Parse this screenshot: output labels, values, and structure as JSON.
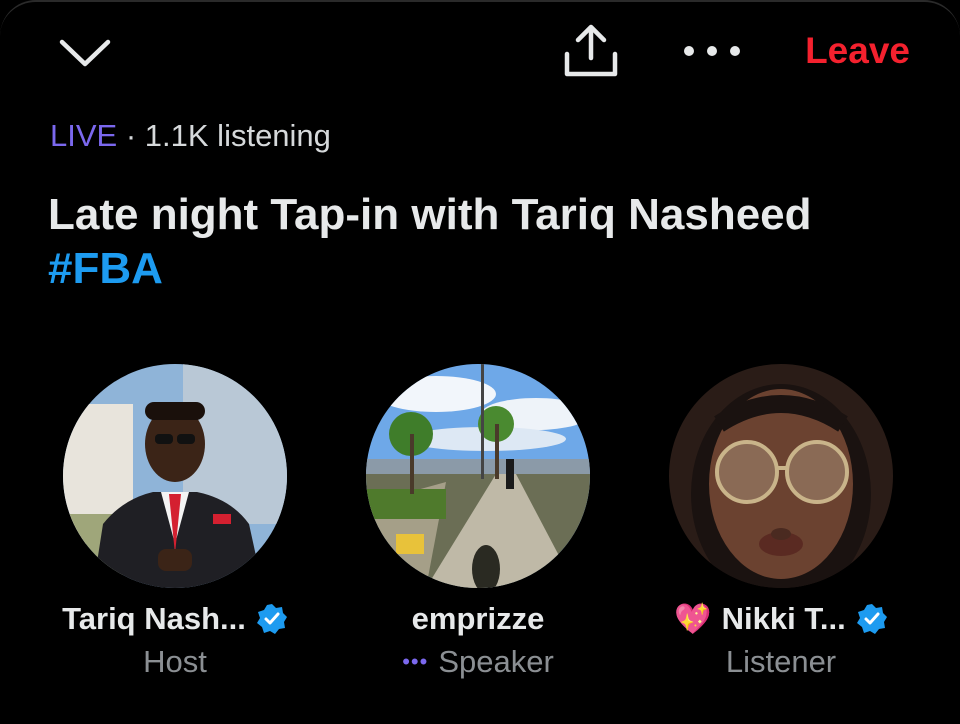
{
  "topbar": {
    "collapse_icon": "chevron-down-icon",
    "share_icon": "share-icon",
    "more_icon": "more-dots-icon",
    "leave_label": "Leave",
    "leave_color": "#f4212e"
  },
  "space": {
    "live_label": "LIVE",
    "separator": "·",
    "listening": "1.1K listening",
    "title_text": "Late night Tap-in with Tariq Nasheed",
    "hashtag": "#FBA",
    "accent_color": "#1d9bf0",
    "live_color": "#7b68ee"
  },
  "participants": [
    {
      "name": "Tariq Nash...",
      "role": "Host",
      "verified": true,
      "emoji": "",
      "speaking_dots": false
    },
    {
      "name": "emprizze",
      "role": "Speaker",
      "verified": false,
      "emoji": "",
      "speaking_dots": true,
      "dots": "•••"
    },
    {
      "name": "Nikki T...",
      "role": "Listener",
      "verified": true,
      "emoji": "💖",
      "speaking_dots": false
    }
  ]
}
